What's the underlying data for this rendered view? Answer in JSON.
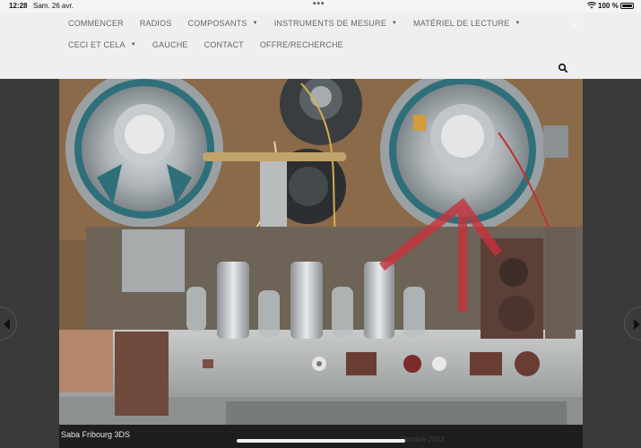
{
  "status": {
    "time": "12:28",
    "date": "Sam. 26 avr.",
    "battery": "100 %",
    "wifi_icon": "wifi-icon"
  },
  "nav": {
    "row1": [
      {
        "label": "COMMENCER",
        "dropdown": false
      },
      {
        "label": "RADIOS",
        "dropdown": false
      },
      {
        "label": "COMPOSANTS",
        "dropdown": true
      },
      {
        "label": "INSTRUMENTS DE MESURE",
        "dropdown": true
      },
      {
        "label": "MATÉRIEL DE LECTURE",
        "dropdown": true
      }
    ],
    "row2": [
      {
        "label": "CECI ET CELA",
        "dropdown": true
      },
      {
        "label": "GAUCHE",
        "dropdown": false
      },
      {
        "label": "CONTACT",
        "dropdown": false
      },
      {
        "label": "OFFRE/RECHERCHE",
        "dropdown": false
      }
    ],
    "close_symbol": "×"
  },
  "lightbox": {
    "caption": "Saba Fribourg 3DS",
    "faint_text": "Octobre 2013"
  },
  "colors": {
    "header_bg": "#efefef",
    "backdrop": "#3a3a3a",
    "caption_bg": "#1e1e1e",
    "annotation_red": "#c8323c"
  }
}
